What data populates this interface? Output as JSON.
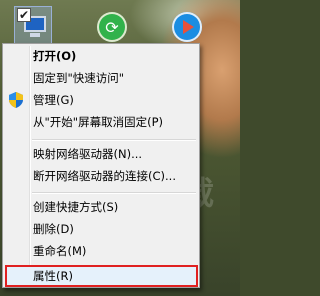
{
  "desktop": {
    "icons": [
      "computer-icon",
      "green-app-icon",
      "media-player-icon"
    ]
  },
  "context_menu": {
    "items": [
      {
        "label": "打开(O)",
        "bold": true
      },
      {
        "label": "固定到\"快速访问\""
      },
      {
        "label": "管理(G)",
        "icon": "shield-icon"
      },
      {
        "label": "从\"开始\"屏幕取消固定(P)"
      },
      {
        "label": "映射网络驱动器(N)..."
      },
      {
        "label": "断开网络驱动器的连接(C)..."
      },
      {
        "label": "创建快捷方式(S)"
      },
      {
        "label": "删除(D)"
      },
      {
        "label": "重命名(M)"
      },
      {
        "label": "属性(R)",
        "highlighted": true
      }
    ]
  },
  "highlight_color": "#e02020",
  "watermark": {
    "text": "下载吧"
  }
}
